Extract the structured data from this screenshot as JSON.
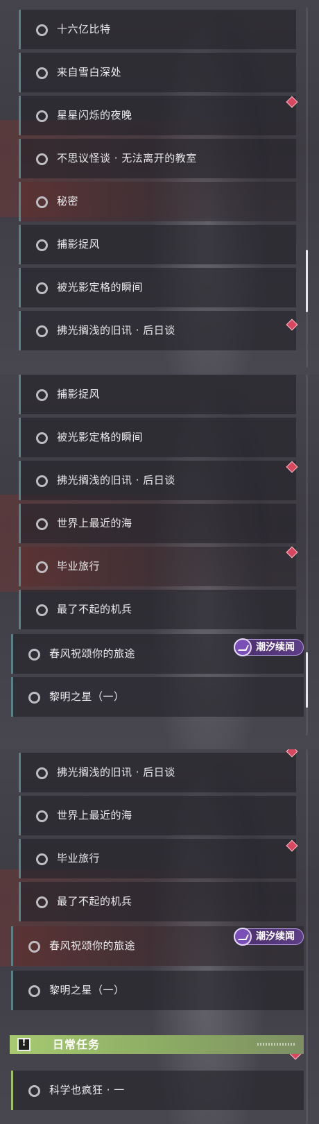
{
  "panel1": {
    "items": [
      {
        "label": "十六亿比特"
      },
      {
        "label": "来自雪白深处"
      },
      {
        "label": "星星闪烁的夜晚"
      },
      {
        "label": "不思议怪谈 · 无法离开的教室"
      },
      {
        "label": "秘密"
      },
      {
        "label": "捕影捉风"
      },
      {
        "label": "被光影定格的瞬间"
      },
      {
        "label": "拂光搁浅的旧讯 · 后日谈"
      }
    ]
  },
  "panel2": {
    "items": [
      {
        "label": "捕影捉风"
      },
      {
        "label": "被光影定格的瞬间"
      },
      {
        "label": "拂光搁浅的旧讯 · 后日谈"
      },
      {
        "label": "世界上最近的海"
      },
      {
        "label": "毕业旅行"
      },
      {
        "label": "最了不起的机兵"
      },
      {
        "label": "春风祝颂你的旅途"
      },
      {
        "label": "黎明之星（一）"
      }
    ],
    "tag": "潮汐续闻"
  },
  "panel3": {
    "items": [
      {
        "label": "拂光搁浅的旧讯 · 后日谈"
      },
      {
        "label": "世界上最近的海"
      },
      {
        "label": "毕业旅行"
      },
      {
        "label": "最了不起的机兵"
      },
      {
        "label": "春风祝颂你的旅途"
      },
      {
        "label": "黎明之星（一）"
      }
    ],
    "tag": "潮汐续闻",
    "daily_section": {
      "title": "日常任务",
      "icon": "exclamation-icon",
      "items": [
        {
          "label": "科学也疯狂 · 一"
        }
      ]
    }
  },
  "colors": {
    "accent_teal": "#5d7f88",
    "daily_green": "#a8c972",
    "marker_red": "#d9475f",
    "tag_purple": "#5d3d85"
  }
}
